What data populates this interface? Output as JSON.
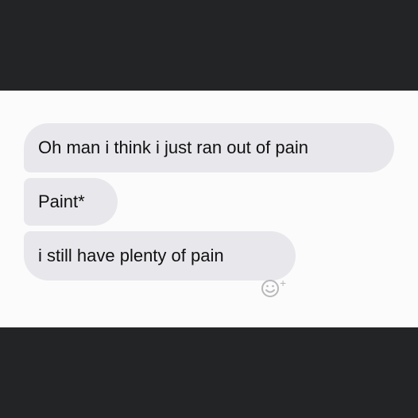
{
  "messages": [
    {
      "text": "Oh man i think i just ran out of pain"
    },
    {
      "text": "Paint*"
    },
    {
      "text": "i still have plenty of pain"
    }
  ],
  "reaction_button": {
    "icon": "smiley-plus-icon",
    "label": "+"
  },
  "colors": {
    "frame": "#232426",
    "panel": "#fbfbfb",
    "bubble": "#e8e7ec",
    "text": "#111111",
    "icon": "#b8b8bc"
  }
}
